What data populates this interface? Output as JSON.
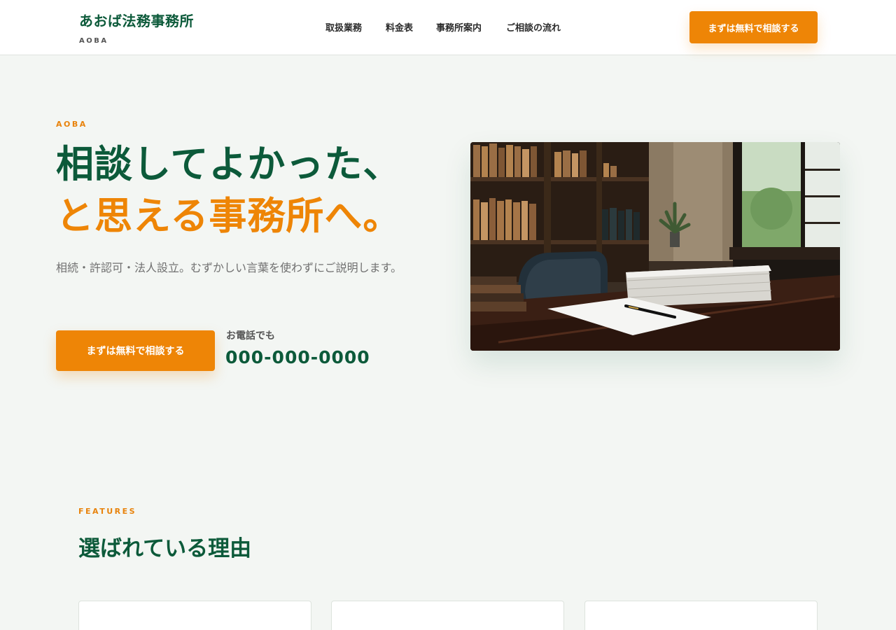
{
  "header": {
    "brand_name": "あおば法務事務所",
    "brand_sub": "AOBA",
    "nav": [
      "取扱業務",
      "料金表",
      "事務所案内",
      "ご相談の流れ"
    ],
    "cta_label": "まずは無料で相談する"
  },
  "hero": {
    "eyebrow": "AOBA",
    "headline_line1": "相談してよかった、",
    "headline_line2": "と思える事務所へ。",
    "lead": "相続・許認可・法人設立。むずかしい言葉を使わずにご説明します。",
    "cta_label": "まずは無料で相談する",
    "phone_label": "お電話でも",
    "phone_number": "000-000-0000"
  },
  "features": {
    "eyebrow": "FEATURES",
    "title": "選ばれている理由"
  },
  "colors": {
    "brand_green": "#0c5a3a",
    "accent_orange": "#ee8506",
    "background": "#f3f6f3"
  }
}
